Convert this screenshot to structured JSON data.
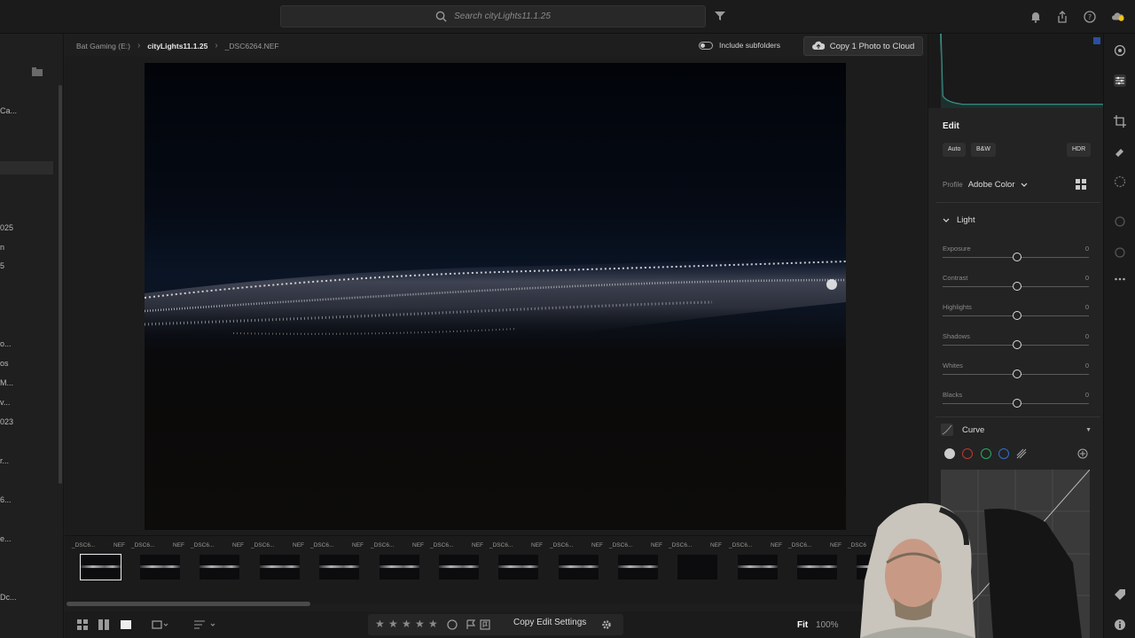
{
  "search": {
    "placeholder": "Search cityLights11.1.25"
  },
  "left_panel": {
    "items": [
      "Ca...",
      "025",
      "n",
      "5",
      "o...",
      "os",
      "M...",
      "v...",
      "023",
      "r...",
      "6...",
      "e...",
      "Dc..."
    ]
  },
  "breadcrumb": {
    "drive": "Bat Gaming  (E:)",
    "folder": "cityLights11.1.25",
    "file": "_DSC6264.NEF"
  },
  "include_subfolders_label": "Include subfolders",
  "copy_cloud_label": "Copy 1 Photo to Cloud",
  "filmstrip": {
    "thumbs": [
      {
        "name": "_DSC6...",
        "ext": "NEF"
      },
      {
        "name": "_DSC6...",
        "ext": "NEF"
      },
      {
        "name": "_DSC6...",
        "ext": "NEF"
      },
      {
        "name": "_DSC6...",
        "ext": "NEF"
      },
      {
        "name": "_DSC6...",
        "ext": "NEF"
      },
      {
        "name": "_DSC6...",
        "ext": "NEF"
      },
      {
        "name": "_DSC6...",
        "ext": "NEF"
      },
      {
        "name": "_DSC6...",
        "ext": "NEF"
      },
      {
        "name": "_DSC6...",
        "ext": "NEF"
      },
      {
        "name": "_DSC6...",
        "ext": "NEF"
      },
      {
        "name": "_DSC6...",
        "ext": "NEF"
      },
      {
        "name": "_DSC6...",
        "ext": "NEF"
      },
      {
        "name": "_DSC6...",
        "ext": "NEF"
      },
      {
        "name": "_DSC6",
        "ext": ""
      }
    ]
  },
  "bottom": {
    "copy_edit_label": "Copy Edit Settings",
    "fit_label": "Fit",
    "zoom_label": "100%"
  },
  "edit": {
    "title": "Edit",
    "auto_label": "Auto",
    "bw_label": "B&W",
    "hdr_label": "HDR",
    "profile_label": "Profile",
    "profile_value": "Adobe Color",
    "light_label": "Light",
    "sliders": [
      {
        "label": "Exposure",
        "value": "0"
      },
      {
        "label": "Contrast",
        "value": "0"
      },
      {
        "label": "Highlights",
        "value": "0"
      },
      {
        "label": "Shadows",
        "value": "0"
      },
      {
        "label": "Whites",
        "value": "0"
      },
      {
        "label": "Blacks",
        "value": "0"
      }
    ],
    "curve_label": "Curve"
  },
  "colors": {
    "accent_blue": "#2a4fa0",
    "histogram_teal": "#3fa89a",
    "curve_red": "#c0392b",
    "curve_green": "#27ae60",
    "curve_blue": "#2f6fd6",
    "notification_yellow": "#f0c419"
  }
}
